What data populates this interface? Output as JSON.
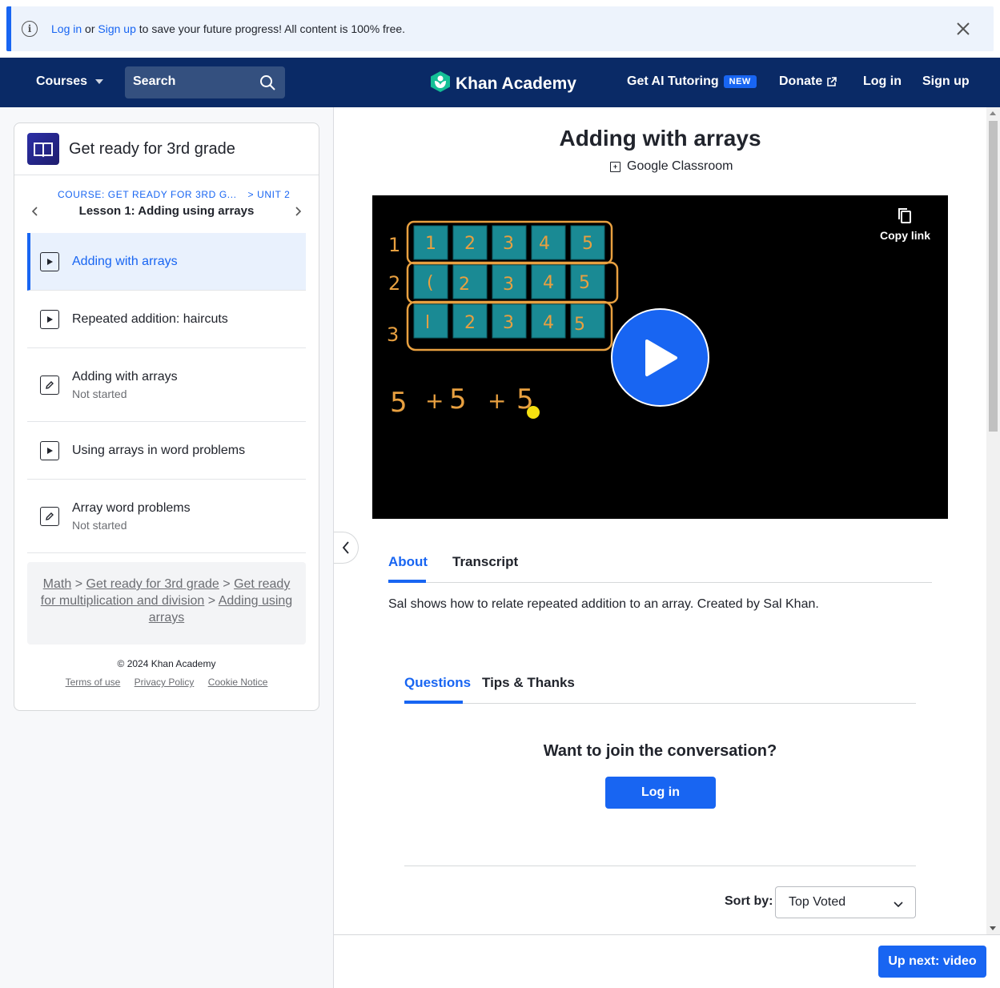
{
  "banner": {
    "login": "Log in",
    "or": "or",
    "signup": "Sign up",
    "message": "to save your future progress! All content is 100% free."
  },
  "nav": {
    "courses": "Courses",
    "search_placeholder": "Search",
    "logo": "Khan Academy",
    "ai_tutoring": "Get AI Tutoring",
    "new_badge": "NEW",
    "donate": "Donate",
    "login": "Log in",
    "signup": "Sign up"
  },
  "sidebar": {
    "course_title": "Get ready for 3rd grade",
    "crumb_course": "COURSE: GET READY FOR 3RD G...",
    "crumb_unit": "> UNIT 2",
    "lesson": "Lesson 1: Adding using arrays",
    "items": [
      {
        "label": "Adding with arrays",
        "type": "video",
        "status": ""
      },
      {
        "label": "Repeated addition: haircuts",
        "type": "video",
        "status": ""
      },
      {
        "label": "Adding with arrays",
        "type": "exercise",
        "status": "Not started"
      },
      {
        "label": "Using arrays in word problems",
        "type": "video",
        "status": ""
      },
      {
        "label": "Array word problems",
        "type": "exercise",
        "status": "Not started"
      }
    ],
    "breadcrumb": {
      "math": "Math",
      "course": "Get ready for 3rd grade",
      "unit": "Get ready for multiplication and division",
      "lesson": "Adding using arrays",
      "sep": ">"
    },
    "footer": {
      "copyright": "© 2024 Khan Academy",
      "terms": "Terms of use",
      "privacy": "Privacy Policy",
      "cookie": "Cookie Notice"
    }
  },
  "main": {
    "title": "Adding with arrays",
    "google_classroom": "Google Classroom",
    "copy_link": "Copy link",
    "tabs": [
      "About",
      "Transcript"
    ],
    "about_text": "Sal shows how to relate repeated addition to an array. Created by Sal Khan.",
    "tabs2": [
      "Questions",
      "Tips & Thanks"
    ],
    "join": "Want to join the conversation?",
    "login_button": "Log in",
    "sort_label": "Sort by:",
    "sort_value": "Top Voted",
    "up_next": "Up next: video"
  },
  "colors": {
    "accent": "#1865f2",
    "nav_bg": "#0a2a66",
    "logo_green": "#14bf96"
  }
}
